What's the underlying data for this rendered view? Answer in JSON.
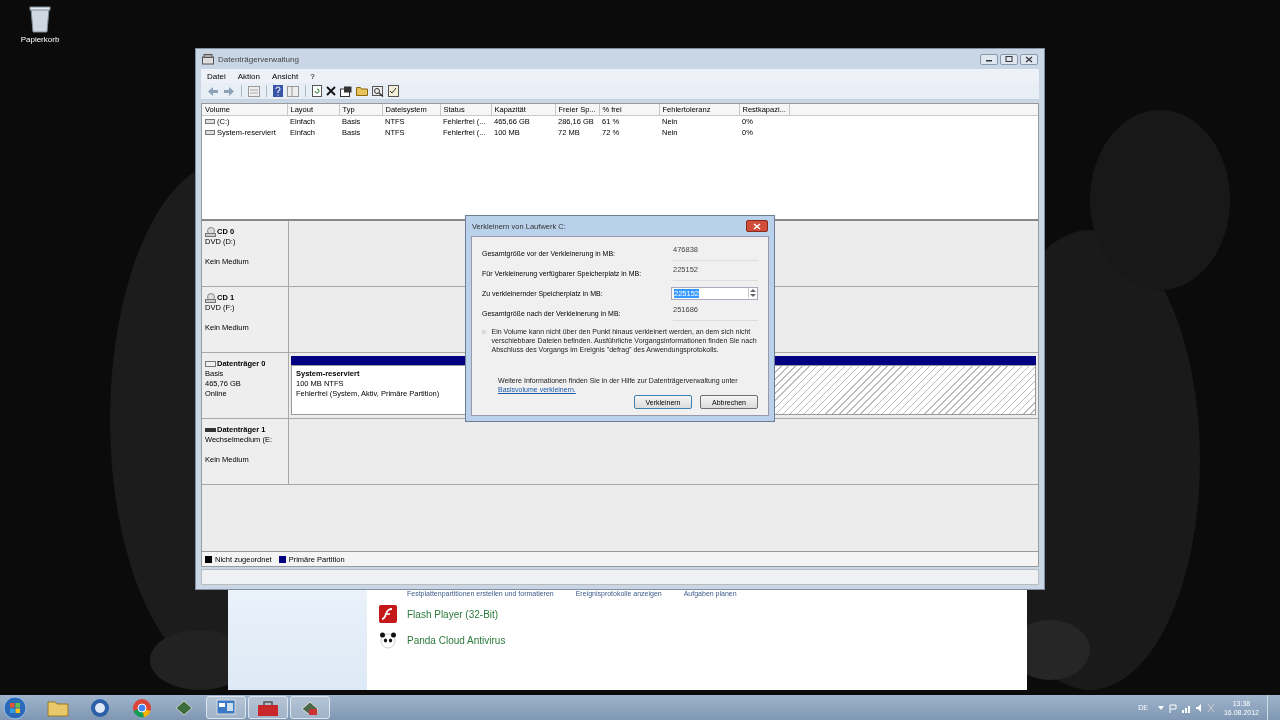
{
  "desktop": {
    "icons": [
      {
        "label": "Papierkorb"
      }
    ]
  },
  "background_window": {
    "links": [
      "Festplattenpartitionen erstellen und formatieren",
      "Ereignisprotokolle anzeigen",
      "Aufgaben planen"
    ],
    "programs": [
      {
        "kind": "flash",
        "name": "Flash Player (32-Bit)"
      },
      {
        "kind": "panda",
        "name": "Panda Cloud Antivirus"
      }
    ]
  },
  "window": {
    "title": "Datenträgerverwaltung",
    "menu": [
      "Datei",
      "Aktion",
      "Ansicht",
      "?"
    ],
    "volume_table": {
      "columns": [
        "Volume",
        "Layout",
        "Typ",
        "Dateisystem",
        "Status",
        "Kapazität",
        "Freier Sp...",
        "% frei",
        "Fehlertoleranz",
        "Restkapazi..."
      ],
      "rows": [
        {
          "cells": [
            "(C:)",
            "Einfach",
            "Basis",
            "NTFS",
            "Fehlerfrei (...",
            "465,66 GB",
            "286,16 GB",
            "61 %",
            "Nein",
            "0%"
          ]
        },
        {
          "cells": [
            "System-reserviert",
            "Einfach",
            "Basis",
            "NTFS",
            "Fehlerfrei (...",
            "100 MB",
            "72 MB",
            "72 %",
            "Nein",
            "0%"
          ]
        }
      ]
    },
    "disks": [
      {
        "kind": "cd",
        "name": "CD 0",
        "lines": [
          "DVD (D:)",
          "Kein Medium"
        ]
      },
      {
        "kind": "cd",
        "name": "CD 1",
        "lines": [
          "DVD (F:)",
          "Kein Medium"
        ]
      },
      {
        "kind": "basic",
        "name": "Datenträger 0",
        "lines": [
          "Basis",
          "465,76 GB",
          "Online"
        ],
        "partitions": [
          {
            "selected": false,
            "name": "System-reserviert",
            "size": "100 MB NTFS",
            "status": "Fehlerfrei (System, Aktiv, Primäre Partition)"
          },
          {
            "selected": true
          }
        ]
      },
      {
        "kind": "removable",
        "name": "Datenträger 1",
        "lines": [
          "Wechselmedium (E:",
          "Kein Medium"
        ]
      }
    ],
    "legend": [
      {
        "label": "Nicht zugeordnet",
        "color": "#000000"
      },
      {
        "label": "Primäre Partition",
        "color": "#000080"
      }
    ]
  },
  "dialog": {
    "title": "Verkleinern von Laufwerk C:",
    "fields": [
      {
        "kind": "readonly",
        "label": "Gesamtgröße vor der Verkleinerung in MB:",
        "value": "476838"
      },
      {
        "kind": "readonly",
        "label": "Für Verkleinerung verfügbarer Speicherplatz in MB:",
        "value": "225152"
      },
      {
        "kind": "spin",
        "label": "Zu verkleinernder Speicherplatz in MB:",
        "value": "225152"
      },
      {
        "kind": "readonly",
        "label": "Gesamtgröße nach der Verkleinerung in MB:",
        "value": "251686"
      }
    ],
    "note": "Ein Volume kann nicht über den Punkt hinaus verkleinert werden, an dem sich nicht verschiebbare Dateien befinden. Ausführliche Vorgangsinformationen finden Sie nach Abschluss des Vorgangs im Ereignis \"defrag\" des Anwendungsprotokolls.",
    "more_info": "Weitere Informationen finden Sie in der Hilfe zur Datenträgerverwaltung unter",
    "link": "Basisvolume verkleinern.",
    "buttons": [
      "Verkleinern",
      "Abbrechen"
    ]
  },
  "taskbar": {
    "apps": [
      {
        "kind": "folder",
        "running": false
      },
      {
        "kind": "mail",
        "running": false
      },
      {
        "kind": "browser",
        "running": false
      },
      {
        "kind": "app",
        "running": false
      },
      {
        "kind": "disk",
        "running": true
      },
      {
        "kind": "toolbox",
        "running": true
      },
      {
        "kind": "disk2",
        "running": true
      }
    ],
    "language": "DE",
    "time": "13:38",
    "date": "16.08.2012"
  }
}
